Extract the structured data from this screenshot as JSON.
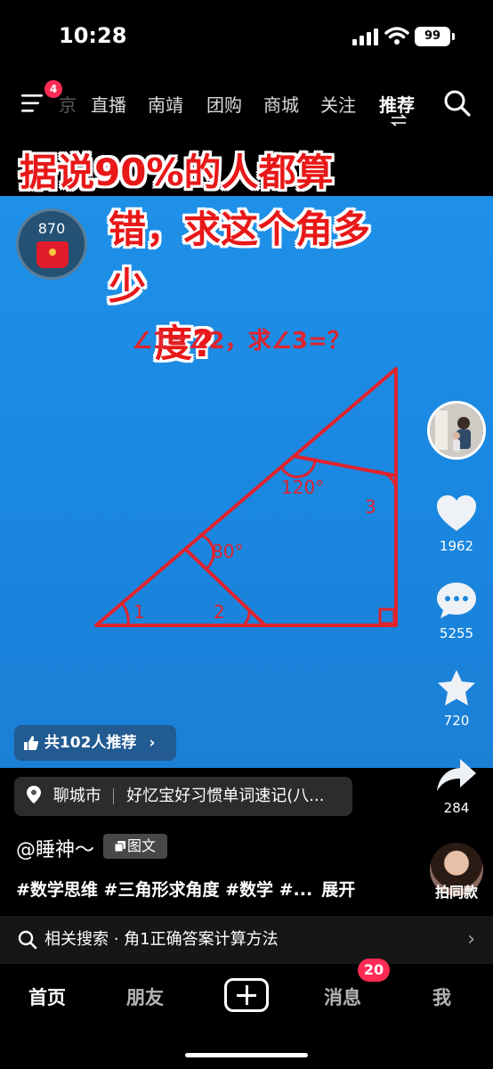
{
  "status_bar": {
    "time": "10:28",
    "battery": "99"
  },
  "top_nav": {
    "menu_badge": "4",
    "fragment": "京",
    "tabs": [
      "直播",
      "南靖",
      "团购",
      "商城",
      "关注",
      "推荐"
    ],
    "active_tab": "推荐"
  },
  "video": {
    "title_line1": "据说90%的人都算",
    "title_line2": "错，求这个角多少",
    "title_line3": "度?",
    "question": "∠1=∠2，求∠3=？",
    "redpack_count": "870",
    "diagram": {
      "angle_120": "120°",
      "angle_80": "80°",
      "label_1": "1",
      "label_2": "2",
      "label_3": "3"
    }
  },
  "side_actions": {
    "like_count": "1962",
    "comment_count": "5255",
    "favorite_count": "720",
    "share_count": "284",
    "duet_label": "拍同款"
  },
  "info": {
    "recommend": "共102人推荐",
    "location": "聊城市",
    "location_extra": "好忆宝好习惯单词速记(八...",
    "author": "@睡神～",
    "type_tag": "图文",
    "hashtags": "#数学思维 #三角形求角度 #数学 #...",
    "expand": "展开"
  },
  "related": {
    "text": "相关搜索 · 角1正确答案计算方法"
  },
  "tab_bar": {
    "tabs": [
      "首页",
      "朋友",
      "消息",
      "我"
    ],
    "message_badge": "20"
  },
  "colors": {
    "accent_red": "#e0232d",
    "video_blue": "#1e90e8",
    "badge": "#fe2c55"
  }
}
